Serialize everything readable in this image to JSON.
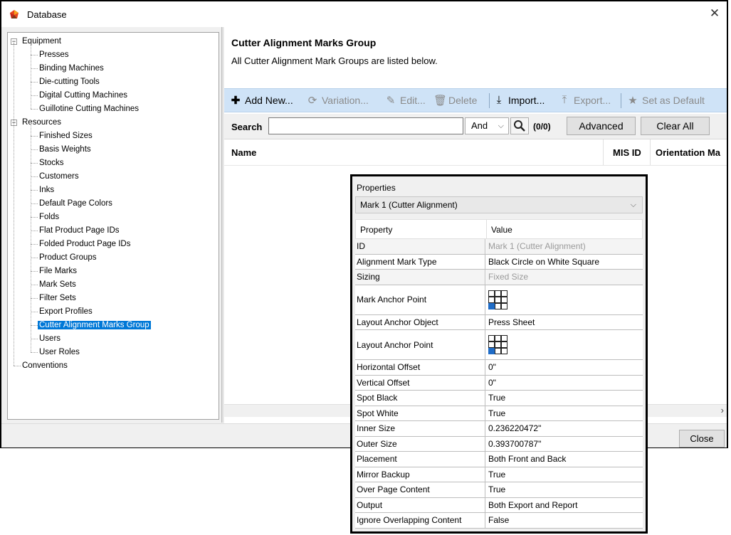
{
  "window": {
    "title": "Database",
    "close_glyph": "✕"
  },
  "tree": {
    "equipment": {
      "label": "Equipment",
      "children": [
        "Presses",
        "Binding Machines",
        "Die-cutting Tools",
        "Digital Cutting Machines",
        "Guillotine Cutting Machines"
      ]
    },
    "resources": {
      "label": "Resources",
      "children": [
        "Finished Sizes",
        "Basis Weights",
        "Stocks",
        "Customers",
        "Inks",
        "Default Page Colors",
        "Folds",
        "Flat Product Page IDs",
        "Folded Product Page IDs",
        "Product Groups",
        "File Marks",
        "Mark Sets",
        "Filter Sets",
        "Export Profiles",
        "Cutter Alignment Marks Group",
        "Users",
        "User Roles"
      ]
    },
    "conventions": {
      "label": "Conventions"
    },
    "selected": "Cutter Alignment Marks Group"
  },
  "main": {
    "title": "Cutter Alignment Marks Group",
    "description": "All Cutter Alignment Mark Groups are listed below.",
    "toolbar": {
      "add_new": "Add New...",
      "variation": "Variation...",
      "edit": "Edit...",
      "delete": "Delete",
      "import": "Import...",
      "export": "Export...",
      "set_default": "Set as Default"
    },
    "search": {
      "label": "Search",
      "value": "",
      "operator": "And",
      "count": "(0/0)",
      "advanced": "Advanced",
      "clear_all": "Clear All"
    },
    "columns": [
      "Name",
      "MIS ID",
      "Orientation Ma"
    ]
  },
  "footer": {
    "close": "Close"
  },
  "properties": {
    "title": "Properties",
    "selected_mark": "Mark 1 (Cutter Alignment)",
    "col_property": "Property",
    "col_value": "Value",
    "rows": [
      {
        "key": "ID",
        "value": "Mark 1 (Cutter Alignment)",
        "dim": true
      },
      {
        "key": "Alignment Mark Type",
        "value": "Black Circle on White Square"
      },
      {
        "key": "Sizing",
        "value": "Fixed Size",
        "dim": true
      },
      {
        "key": "Mark Anchor Point",
        "value": "",
        "anchor": true
      },
      {
        "key": "Layout Anchor Object",
        "value": "Press Sheet"
      },
      {
        "key": "Layout Anchor Point",
        "value": "",
        "anchor": true
      },
      {
        "key": "Horizontal Offset",
        "value": "0\""
      },
      {
        "key": "Vertical Offset",
        "value": "0\""
      },
      {
        "key": "Spot Black",
        "value": "True"
      },
      {
        "key": "Spot White",
        "value": "True"
      },
      {
        "key": "Inner Size",
        "value": "0.236220472\""
      },
      {
        "key": "Outer Size",
        "value": "0.393700787\""
      },
      {
        "key": "Placement",
        "value": "Both Front and Back"
      },
      {
        "key": "Mirror Backup",
        "value": "True"
      },
      {
        "key": "Over Page Content",
        "value": "True"
      },
      {
        "key": "Output",
        "value": "Both Export and Report"
      },
      {
        "key": "Ignore Overlapping Content",
        "value": "False"
      }
    ]
  },
  "colors": {
    "selection": "#0078d7",
    "toolbar_bg": "#cfe3f7",
    "anchor_selected": "#1f6cc7"
  }
}
